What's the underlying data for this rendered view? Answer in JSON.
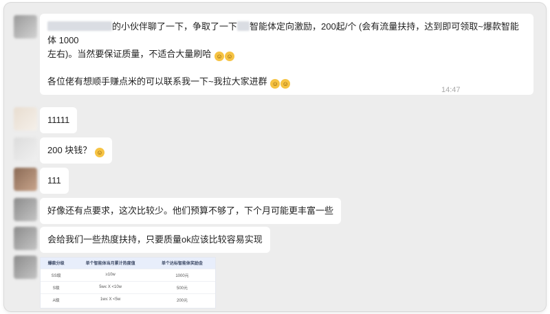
{
  "messages": [
    {
      "line1_suffix": "的小伙伴聊了一下，争取了一下",
      "line1_mid": "智能体定向激励，200起/个 (会有流量扶持，达到即可领取~爆款智能体 1000",
      "line2": "左右)。当然要保证质量，不适合大量刷哈",
      "line3": "各位佬有想顺手赚点米的可以联系我一下~我拉大家进群"
    }
  ],
  "timestamp": "14:47",
  "replies": [
    {
      "text": "11111"
    },
    {
      "text": "200 块钱？"
    },
    {
      "text": "111"
    },
    {
      "text": "好像还有点要求，这次比较少。他们预算不够了，下个月可能更丰富一些"
    },
    {
      "text": "会给我们一些热度扶持，只要质量ok应该比较容易实现"
    }
  ],
  "table_image": {
    "headers": [
      "爆款分级",
      "单个智能体当月累计热度值",
      "单个达标智能体奖励金"
    ],
    "rows": [
      [
        "SS级",
        "≥10w",
        "1000元"
      ],
      [
        "S级",
        "5w≤ X <10w",
        "500元"
      ],
      [
        "A级",
        "1w≤ X <5w",
        "200元"
      ]
    ]
  },
  "colors": {
    "chat_background": "#ededed",
    "bubble": "#ffffff",
    "text": "#222222",
    "timestamp": "#a8a8a8"
  }
}
